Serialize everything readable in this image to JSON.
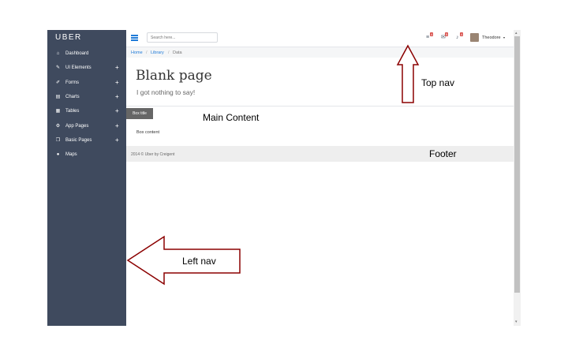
{
  "app": {
    "brand": "UBER",
    "sidebar": {
      "items": [
        {
          "label": "Dashboard",
          "icon": "home-icon",
          "glyph": "⌂",
          "expandable": false
        },
        {
          "label": "UI Elements",
          "icon": "wrench-icon",
          "glyph": "✎",
          "expandable": true
        },
        {
          "label": "Forms",
          "icon": "edit-icon",
          "glyph": "✐",
          "expandable": true
        },
        {
          "label": "Charts",
          "icon": "chart-icon",
          "glyph": "▤",
          "expandable": true
        },
        {
          "label": "Tables",
          "icon": "table-icon",
          "glyph": "▦",
          "expandable": true
        },
        {
          "label": "App Pages",
          "icon": "gears-icon",
          "glyph": "⚙",
          "expandable": true
        },
        {
          "label": "Basic Pages",
          "icon": "copy-icon",
          "glyph": "❐",
          "expandable": true
        },
        {
          "label": "Maps",
          "icon": "map-marker-icon",
          "glyph": "●",
          "expandable": false
        }
      ],
      "plus_glyph": "+"
    },
    "topbar": {
      "search_placeholder": "Search here...",
      "icons": [
        {
          "name": "tasks-icon",
          "glyph": "≡",
          "badge": "4"
        },
        {
          "name": "envelope-icon",
          "glyph": "✉",
          "badge": "5"
        },
        {
          "name": "bell-icon",
          "glyph": "♪",
          "badge": "4"
        }
      ],
      "user_name": "Theodore",
      "caret": "▾"
    },
    "breadcrumb": [
      "Home",
      "Library",
      "Data"
    ],
    "breadcrumb_sep": "/",
    "page_title": "Blank page",
    "page_subtitle": "I got nothing to say!",
    "box": {
      "title": "Box title",
      "content": "Box content"
    },
    "footer_text": "2014 © Uber by Creigent",
    "scroll_up": "▴",
    "scroll_down": "▾",
    "colors": {
      "sidebar": "#3f4a5e",
      "accent": "#1f7bd8",
      "badge": "#d9534f"
    }
  },
  "annotations": {
    "top_nav": "Top nav",
    "main_content": "Main Content",
    "footer": "Footer",
    "left_nav": "Left nav",
    "arrow_color": "#8b0000"
  }
}
